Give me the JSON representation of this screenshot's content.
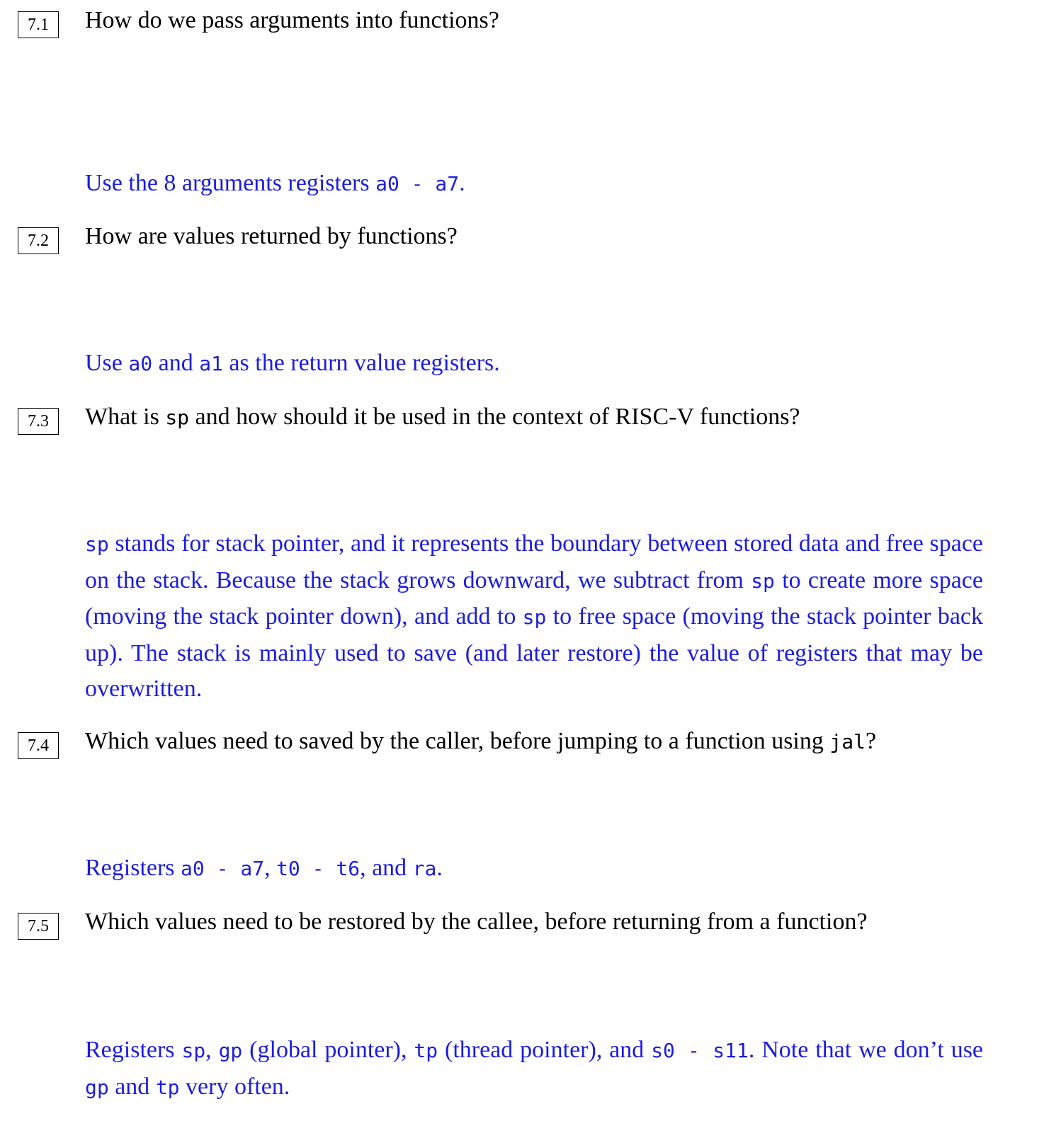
{
  "questions": [
    {
      "number": "7.1",
      "question": [
        "How do we pass arguments into functions?"
      ],
      "answer": [
        "Use the 8 arguments registers ",
        {
          "code": "a0 - a7"
        },
        "."
      ]
    },
    {
      "number": "7.2",
      "question": [
        "How are values returned by functions?"
      ],
      "answer": [
        "Use ",
        {
          "code": "a0"
        },
        " and ",
        {
          "code": "a1"
        },
        " as the return value registers."
      ]
    },
    {
      "number": "7.3",
      "question": [
        "What is ",
        {
          "code": "sp"
        },
        " and how should it be used in the context of RISC-V functions?"
      ],
      "answer": [
        {
          "code": "sp"
        },
        " stands for stack pointer, and it represents the boundary between stored data and free space on the stack. Because the stack grows downward, we subtract from ",
        {
          "code": "sp"
        },
        " to create more space (moving the stack pointer down), and add to ",
        {
          "code": "sp"
        },
        " to free space (moving the stack pointer back up). The stack is mainly used to save (and later restore) the value of registers that may be overwritten."
      ]
    },
    {
      "number": "7.4",
      "question": [
        "Which values need to saved by the caller, before jumping to a function using ",
        {
          "code": "jal"
        },
        "?"
      ],
      "answer": [
        "Registers ",
        {
          "code": "a0 - a7"
        },
        ", ",
        {
          "code": "t0 - t6"
        },
        ", and ",
        {
          "code": "ra"
        },
        "."
      ]
    },
    {
      "number": "7.5",
      "question": [
        "Which values need to be restored by the callee, before returning from a function?"
      ],
      "answer": [
        "Registers ",
        {
          "code": "sp"
        },
        ", ",
        {
          "code": "gp"
        },
        " (global pointer), ",
        {
          "code": "tp"
        },
        " (thread pointer), and ",
        {
          "code": "s0 - s11"
        },
        ". Note that we don’t use ",
        {
          "code": "gp"
        },
        " and ",
        {
          "code": "tp"
        },
        " very often."
      ]
    }
  ]
}
